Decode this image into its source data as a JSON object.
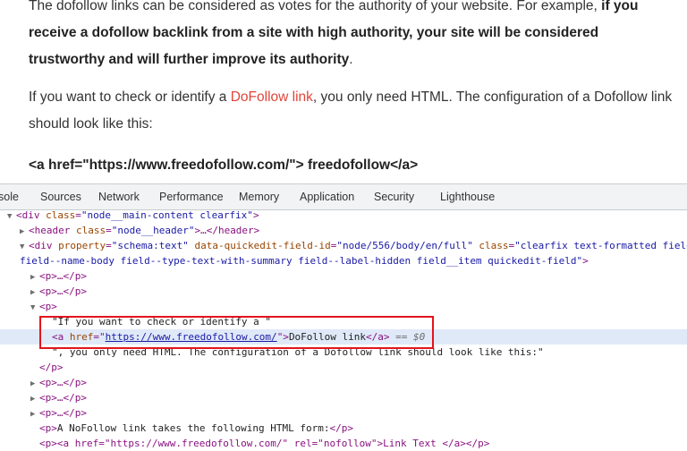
{
  "article": {
    "p1_text": "The dofollow links can be considered as votes for the authority of your website. For example, ",
    "p1_bold": "if you receive a dofollow backlink from a site with high authority, your site will be considered trustworthy and will further improve its authority",
    "p1_end": ".",
    "p2_before": "If you want to check or identify a ",
    "p2_link": "DoFollow link",
    "p2_after": ", you only need HTML. The configuration of a Dofollow link should look like this:",
    "code_example": "<a href=\"https://www.freedofollow.com/\"> freedofollow</a>"
  },
  "devtools": {
    "tabs": [
      "sole",
      "Sources",
      "Network",
      "Performance",
      "Memory",
      "Application",
      "Security",
      "Lighthouse"
    ],
    "lines": {
      "l1": {
        "open": "<div ",
        "attr": "class",
        "val": "\"node__main-content clearfix\"",
        "close": ">"
      },
      "l2": {
        "open": "<header ",
        "attr": "class",
        "val": "\"node__header\"",
        "mid": ">…</header>"
      },
      "l3": {
        "open": "<div ",
        "a1": "property",
        "v1": "\"schema:text\"",
        "a2": "data-quickedit-field-id",
        "v2": "\"node/556/body/en/full\"",
        "a3": "class",
        "v3": "\"clearfix text-formatted field"
      },
      "l3b": "field--name-body field--type-text-with-summary field--label-hidden field__item quickedit-field\"",
      "l3b_close": ">",
      "p_collapsed": "<p>…</p>",
      "p_open": "<p>",
      "text1": "\"If you want to check or identify a \"",
      "a_open": "<a ",
      "a_attr": "href",
      "a_val": "https://www.freedofollow.com/",
      "a_text": "DoFollow link",
      "a_close": "</a>",
      "a_eq": "== $0",
      "text2": "\", you only need HTML. The configuration of a Dofollow link should look like this:\"",
      "p_close": "</p>",
      "nofollow_open": "<p>",
      "nofollow_text": "A NoFollow link takes the following HTML form:",
      "nofollow_close": "</p>",
      "last_line": "<p><a href=\"https://www.freedofollow.com/\" rel=\"nofollow\">Link Text </a></p>"
    }
  }
}
